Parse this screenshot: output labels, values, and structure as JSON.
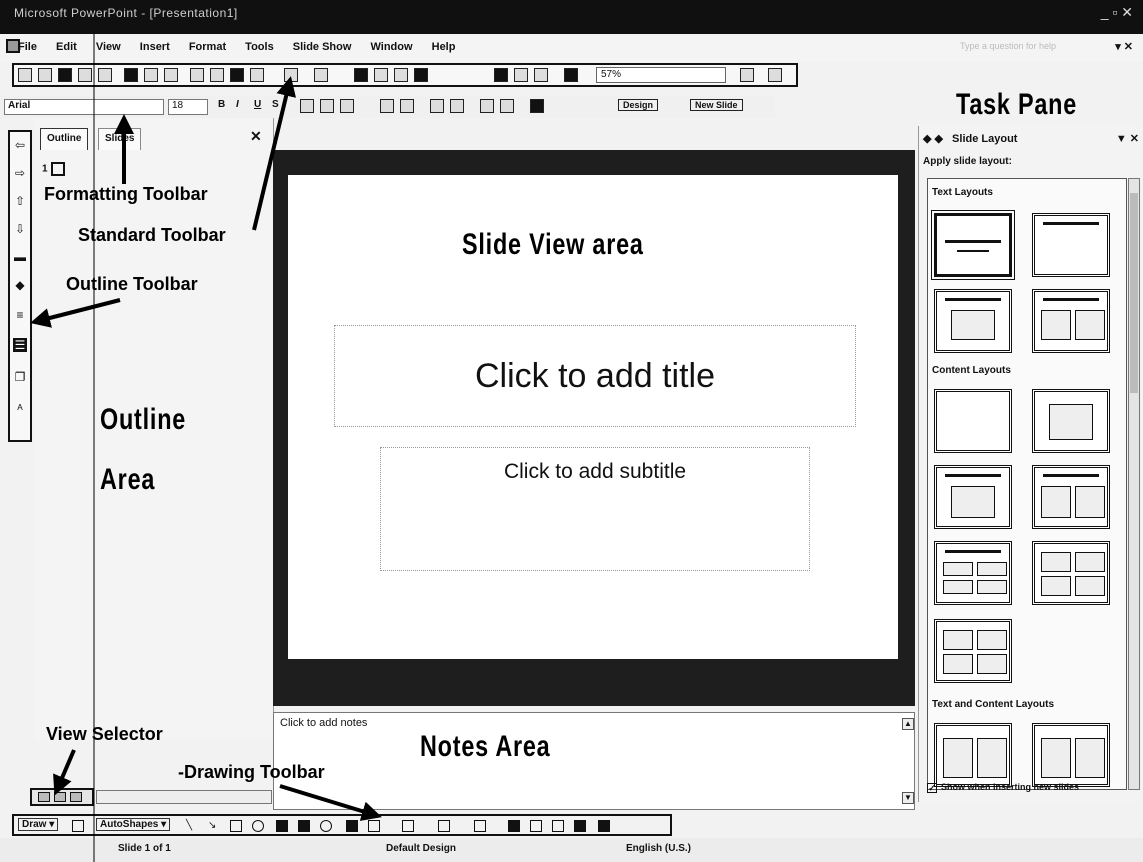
{
  "window": {
    "title": "Microsoft PowerPoint - [Presentation1]",
    "controls": "_ ▫ ✕"
  },
  "menubar": {
    "items": [
      "File",
      "Edit",
      "View",
      "Insert",
      "Format",
      "Tools",
      "Slide Show",
      "Window",
      "Help"
    ],
    "help_box": "Type a question for help",
    "close": "▾ ✕"
  },
  "standard_toolbar": {
    "zoom": "57%"
  },
  "formatting_toolbar": {
    "font": "Arial",
    "size": "18",
    "bold": "B",
    "italic": "I",
    "underline": "U",
    "shadow": "S",
    "design": "Design",
    "new_slide": "New Slide"
  },
  "outline_pane": {
    "tabs": [
      "Outline",
      "Slides"
    ],
    "close": "✕",
    "slide_number": "1"
  },
  "slide": {
    "title_placeholder": "Click to add title",
    "subtitle_placeholder": "Click to add subtitle"
  },
  "notes": {
    "placeholder": "Click to add notes"
  },
  "drawing_toolbar": {
    "draw": "Draw ▾",
    "autoshapes": "AutoShapes ▾"
  },
  "statusbar": {
    "slide": "Slide 1 of 1",
    "design": "Default Design",
    "language": "English (U.S.)"
  },
  "task_pane": {
    "title": "Slide Layout",
    "nav": "◆ ◆",
    "controls": "▼ ✕",
    "apply_label": "Apply slide layout:",
    "sections": [
      "Text Layouts",
      "Content Layouts",
      "Text and Content Layouts"
    ],
    "checkbox_label": "Show when inserting new slides",
    "checkbox_checked": true
  },
  "annotations": {
    "task_pane": "Task Pane",
    "formatting_toolbar": "Formatting Toolbar",
    "standard_toolbar": "Standard Toolbar",
    "outline_toolbar": "Outline Toolbar",
    "outline_area": "Outline Area",
    "slide_view_area": "Slide View area",
    "notes_area": "Notes Area",
    "view_selector": "View Selector",
    "drawing_toolbar": "-Drawing Toolbar"
  }
}
